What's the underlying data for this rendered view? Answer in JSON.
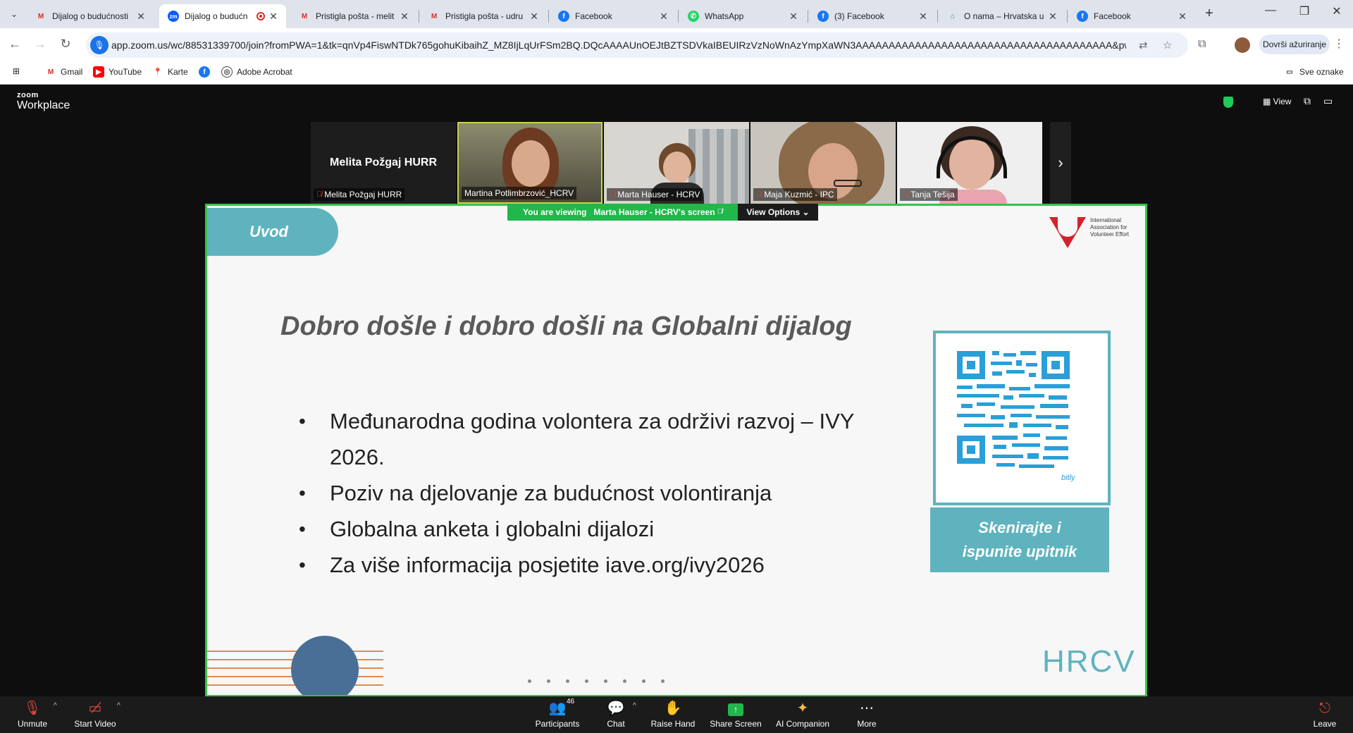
{
  "browser": {
    "tabs": [
      {
        "title": "Dijalog o budućnosti",
        "icon": "gmail-icon",
        "active": false
      },
      {
        "title": "Dijalog o budućn",
        "icon": "zoom-icon",
        "active": true
      },
      {
        "title": "Pristigla pošta - melit",
        "icon": "gmail-icon",
        "active": false
      },
      {
        "title": "Pristigla pošta - udru",
        "icon": "gmail-icon",
        "active": false
      },
      {
        "title": "Facebook",
        "icon": "facebook-icon",
        "active": false
      },
      {
        "title": "WhatsApp",
        "icon": "whatsapp-icon",
        "active": false
      },
      {
        "title": "(3) Facebook",
        "icon": "facebook-icon",
        "active": false
      },
      {
        "title": "O nama – Hrvatska u",
        "icon": "hrvatska-icon",
        "active": false
      },
      {
        "title": "Facebook",
        "icon": "facebook-icon",
        "active": false
      }
    ],
    "url": "app.zoom.us/wc/88531339700/join?fromPWA=1&tk=qnVp4FiswNTDk765gohuKibaihZ_MZ8IjLqUrFSm2BQ.DQcAAAAUnOEJtBZTSDVkaIBEUIRzVzNoWnAzYmpXaWN3AAAAAAAAAAAAAAAAAAAAAAAAAAAAAAAAAAAAAAA&pwd=wt...",
    "update_label": "Dovrši ažuriranje",
    "bookmarks": [
      {
        "label": "Gmail",
        "icon": "gmail-icon"
      },
      {
        "label": "YouTube",
        "icon": "youtube-icon"
      },
      {
        "label": "Karte",
        "icon": "maps-icon"
      },
      {
        "label": "",
        "icon": "facebook-icon"
      },
      {
        "label": "Adobe Acrobat",
        "icon": "acrobat-icon"
      }
    ],
    "all_bookmarks_label": "Sve oznake"
  },
  "zoom": {
    "logo_top": "zoom",
    "logo_bottom": "Workplace",
    "view_label": "View",
    "participants_strip": [
      {
        "name": "Melita Požgaj HURR",
        "display_name": "Melita Požgaj HURR",
        "video": false,
        "muted": true
      },
      {
        "name": "Martina Potlimbrzović_HCRV",
        "video": true,
        "muted": false,
        "active": true
      },
      {
        "name": "Marta Hauser - HCRV",
        "video": true,
        "muted": true
      },
      {
        "name": "Maja Kuzmić - IPC",
        "video": true,
        "muted": true
      },
      {
        "name": "Tanja Tešija",
        "video": true,
        "muted": true
      }
    ],
    "viewing_prefix": "You are viewing",
    "viewing_name": "Marta Hauser - HCRV's screen",
    "view_options": "View Options",
    "controls": {
      "unmute": "Unmute",
      "start_video": "Start Video",
      "participants": "Participants",
      "participants_count": "46",
      "chat": "Chat",
      "raise_hand": "Raise Hand",
      "share_screen": "Share Screen",
      "ai_companion": "AI Companion",
      "more": "More",
      "leave": "Leave"
    }
  },
  "slide": {
    "section": "Uvod",
    "logo_text": "International Association for Volunteer Effort",
    "title": "Dobro došle i dobro došli na Globalni dijalog",
    "bullets": [
      "Međunarodna godina volontera za održivi razvoj – IVY 2026.",
      "Poziv na djelovanje za budućnost volontiranja",
      "Globalna anketa i globalni dijalozi",
      "Za više informacija posjetite iave.org/ivy2026"
    ],
    "qr_caption_line1": "Skenirajte i",
    "qr_caption_line2": "ispunite upitnik",
    "qr_brand": "bitly",
    "footer_logo": "HRCV",
    "colors": {
      "teal": "#5fb3bf",
      "red": "#d2242b",
      "orange": "#e6884d",
      "navy": "#4a6f96",
      "zoom_green": "#21b74a"
    }
  }
}
